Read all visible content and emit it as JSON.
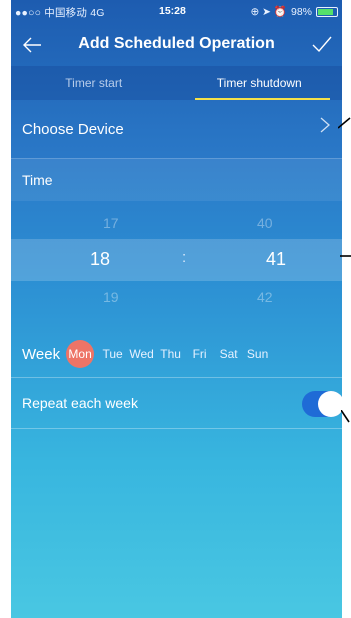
{
  "status_bar": {
    "carrier": "●●○○ 中国移动 4G",
    "time": "15:28",
    "battery": "98%"
  },
  "nav": {
    "title": "Add Scheduled Operation"
  },
  "tabs": [
    {
      "label": "Timer start"
    },
    {
      "label": "Timer shutdown"
    }
  ],
  "device_row": {
    "label": "Choose Device"
  },
  "time_section": {
    "label": "Time",
    "hours": [
      "17",
      "18",
      "19"
    ],
    "minutes": [
      "40",
      "41",
      "42"
    ],
    "separator": ":"
  },
  "week": {
    "label": "Week",
    "days": [
      "Mon",
      "Tue",
      "Wed",
      "Thu",
      "Fri",
      "Sat",
      "Sun"
    ],
    "selected": "Mon"
  },
  "repeat": {
    "label": "Repeat each week",
    "on": true
  },
  "colors": {
    "tab_indicator": "#f5e14a",
    "selected_day": "#ee7466",
    "toggle_on": "#1f6bd6"
  }
}
